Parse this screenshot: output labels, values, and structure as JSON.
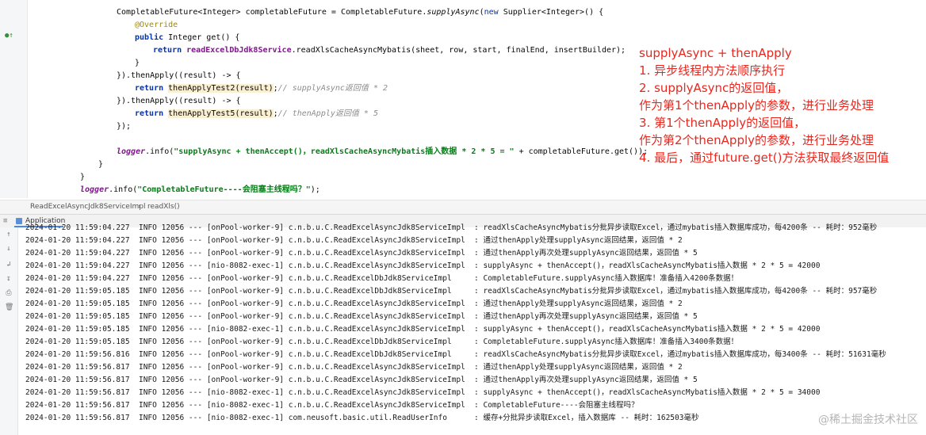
{
  "editor": {
    "lines": {
      "l1": {
        "type": "CompletableFuture<Integer>",
        "var": " completableFuture = CompletableFuture.",
        "method": "supplyAsync",
        "rest1": "(",
        "new": "new",
        "rest2": " Supplier<Integer>() {"
      },
      "l2": "@Override",
      "l3": {
        "kw": "public",
        "rest": " Integer get() {"
      },
      "l4": {
        "kw": "return",
        "rest": " readExcelDbJdk8Service",
        "rest2": ".readXlsCacheAsyncMybatis(sheet, row, start, finalEnd, insertBuilder);"
      },
      "l5": "}",
      "l6": "}).thenApply((result) -> {",
      "l7": {
        "kw": "return",
        "call": "thenApplyTest2(result)",
        "end": ";",
        "cmt": "// supplyAsync返回值 * 2"
      },
      "l8": "}).thenApply((result) -> {",
      "l9": {
        "kw": "return",
        "call": "thenApplyTest5(result)",
        "end": ";",
        "cmt": "// thenApply返回值 * 5"
      },
      "l10": "});",
      "l11": {
        "logger": "logger",
        "info": ".info(",
        "str": "\"supplyAsync + thenAccept()，readXlsCacheAsyncMybatis插入数据 * 2 * 5 = \"",
        "rest": " + completableFuture.get());"
      },
      "l12": "}",
      "l13": "}",
      "l14": {
        "logger": "logger",
        "info": ".info(",
        "str": "\"CompletableFuture----会阻塞主线程吗？\"",
        "rest": ");"
      }
    }
  },
  "annotation": {
    "color": "#e8271e",
    "lines": [
      "supplyAsync + thenApply",
      "1. 异步线程内方法顺序执行",
      "2. supplyAsync的返回值，",
      "作为第1个thenApply的参数，进行业务处理",
      "3. 第1个thenApply的返回值，",
      "作为第2个thenApply的参数，进行业务处理",
      "4. 最后，通过future.get()方法获取最终返回值"
    ]
  },
  "breadcrumb": {
    "class": "ReadExcelAsyncJdk8ServiceImpl",
    "sep": "›",
    "method": "readXls()"
  },
  "run_panel": {
    "tab_label": "Application"
  },
  "console": {
    "lines": [
      {
        "prefix": "2024-01-20 11:59:04.227  INFO 12056 --- [onPool-worker-9] c.n.b.u.C.ReadExcelAsyncJdk8ServiceImpl",
        "msg": ": readXlsCacheAsyncMybatis分批异步读取Excel，通过mybatis插入数据库成功，每4200条 -- 耗时：952毫秒"
      },
      {
        "prefix": "2024-01-20 11:59:04.227  INFO 12056 --- [onPool-worker-9] c.n.b.u.C.ReadExcelAsyncJdk8ServiceImpl",
        "msg": ": 通过thenApply处理supplyAsync返回结果，返回值 * 2"
      },
      {
        "prefix": "2024-01-20 11:59:04.227  INFO 12056 --- [onPool-worker-9] c.n.b.u.C.ReadExcelAsyncJdk8ServiceImpl",
        "msg": ": 通过thenApply再次处理supplyAsync返回结果，返回值 * 5"
      },
      {
        "prefix": "2024-01-20 11:59:04.227  INFO 12056 --- [nio-8082-exec-1] c.n.b.u.C.ReadExcelAsyncJdk8ServiceImpl",
        "msg": ": supplyAsync + thenAccept()，readXlsCacheAsyncMybatis插入数据 * 2 * 5 = 42000"
      },
      {
        "prefix": "2024-01-20 11:59:04.227  INFO 12056 --- [onPool-worker-9] c.n.b.u.C.ReadExcelDbJdk8ServiceImpl",
        "msg": ": CompletableFuture.supplyAsync插入数据库！准备插入4200条数据！"
      },
      {
        "prefix": "2024-01-20 11:59:05.185  INFO 12056 --- [onPool-worker-9] c.n.b.u.C.ReadExcelDbJdk8ServiceImpl",
        "msg": ": readXlsCacheAsyncMybatis分批异步读取Excel，通过mybatis插入数据库成功，每4200条 -- 耗时：957毫秒"
      },
      {
        "prefix": "2024-01-20 11:59:05.185  INFO 12056 --- [onPool-worker-9] c.n.b.u.C.ReadExcelAsyncJdk8ServiceImpl",
        "msg": ": 通过thenApply处理supplyAsync返回结果，返回值 * 2"
      },
      {
        "prefix": "2024-01-20 11:59:05.185  INFO 12056 --- [onPool-worker-9] c.n.b.u.C.ReadExcelAsyncJdk8ServiceImpl",
        "msg": ": 通过thenApply再次处理supplyAsync返回结果，返回值 * 5"
      },
      {
        "prefix": "2024-01-20 11:59:05.185  INFO 12056 --- [nio-8082-exec-1] c.n.b.u.C.ReadExcelAsyncJdk8ServiceImpl",
        "msg": ": supplyAsync + thenAccept()，readXlsCacheAsyncMybatis插入数据 * 2 * 5 = 42000"
      },
      {
        "prefix": "2024-01-20 11:59:05.185  INFO 12056 --- [onPool-worker-9] c.n.b.u.C.ReadExcelDbJdk8ServiceImpl",
        "msg": ": CompletableFuture.supplyAsync插入数据库！准备插入3400条数据！"
      },
      {
        "prefix": "2024-01-20 11:59:56.816  INFO 12056 --- [onPool-worker-9] c.n.b.u.C.ReadExcelDbJdk8ServiceImpl",
        "msg": ": readXlsCacheAsyncMybatis分批异步读取Excel，通过mybatis插入数据库成功，每3400条 -- 耗时：51631毫秒"
      },
      {
        "prefix": "2024-01-20 11:59:56.817  INFO 12056 --- [onPool-worker-9] c.n.b.u.C.ReadExcelAsyncJdk8ServiceImpl",
        "msg": ": 通过thenApply处理supplyAsync返回结果，返回值 * 2"
      },
      {
        "prefix": "2024-01-20 11:59:56.817  INFO 12056 --- [onPool-worker-9] c.n.b.u.C.ReadExcelAsyncJdk8ServiceImpl",
        "msg": ": 通过thenApply再次处理supplyAsync返回结果，返回值 * 5"
      },
      {
        "prefix": "2024-01-20 11:59:56.817  INFO 12056 --- [nio-8082-exec-1] c.n.b.u.C.ReadExcelAsyncJdk8ServiceImpl",
        "msg": ": supplyAsync + thenAccept()，readXlsCacheAsyncMybatis插入数据 * 2 * 5 = 34000"
      },
      {
        "prefix": "2024-01-20 11:59:56.817  INFO 12056 --- [nio-8082-exec-1] c.n.b.u.C.ReadExcelAsyncJdk8ServiceImpl",
        "msg": ": CompletableFuture----会阻塞主线程吗？"
      },
      {
        "prefix": "2024-01-20 11:59:56.817  INFO 12056 --- [nio-8082-exec-1] com.neusoft.basic.util.ReadUserInfo",
        "msg": ": 缓存+分批异步读取Excel，插入数据库 -- 耗时：162503毫秒"
      }
    ]
  },
  "watermark": "@稀土掘金技术社区",
  "icons": {
    "gutter_override": "override-icon",
    "console_tools": [
      "up-arrow-icon",
      "down-arrow-icon",
      "wrap-icon",
      "scroll-end-icon",
      "print-icon",
      "trash-icon"
    ]
  }
}
